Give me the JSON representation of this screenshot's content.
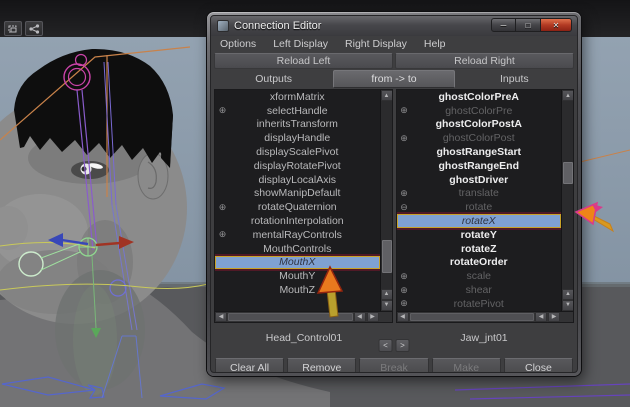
{
  "colors": {
    "selection_bg": "#7fa1d2",
    "selection_border": "#c9a227",
    "annotation_orange": "#e8791e",
    "annotation_pink": "#d83a8c",
    "close_button_red": "#b23a23",
    "viewport_sky": "#8a99a8",
    "viewport_ground": "#58595c"
  },
  "viewport": {
    "toolbar_icons": [
      "frame-icon",
      "share-icon"
    ]
  },
  "dialog": {
    "title": "Connection Editor",
    "menu_items": [
      "Options",
      "Left Display",
      "Right Display",
      "Help"
    ],
    "reload_buttons": [
      "Reload Left",
      "Reload Right"
    ],
    "tabs": [
      "Outputs",
      "from -> to",
      "Inputs"
    ],
    "left_list": {
      "items": [
        {
          "label": "xformMatrix",
          "style": "normal",
          "expand": ""
        },
        {
          "label": "selectHandle",
          "style": "normal",
          "expand": "+"
        },
        {
          "label": "inheritsTransform",
          "style": "normal",
          "expand": ""
        },
        {
          "label": "displayHandle",
          "style": "normal",
          "expand": ""
        },
        {
          "label": "displayScalePivot",
          "style": "normal",
          "expand": ""
        },
        {
          "label": "displayRotatePivot",
          "style": "normal",
          "expand": ""
        },
        {
          "label": "displayLocalAxis",
          "style": "normal",
          "expand": ""
        },
        {
          "label": "showManipDefault",
          "style": "normal",
          "expand": ""
        },
        {
          "label": "rotateQuaternion",
          "style": "normal",
          "expand": "+"
        },
        {
          "label": "rotationInterpolation",
          "style": "normal",
          "expand": ""
        },
        {
          "label": "mentalRayControls",
          "style": "normal",
          "expand": "+"
        },
        {
          "label": "MouthControls",
          "style": "normal",
          "expand": ""
        },
        {
          "label": "MouthX",
          "style": "selected",
          "expand": ""
        },
        {
          "label": "MouthY",
          "style": "normal",
          "expand": ""
        },
        {
          "label": "MouthZ",
          "style": "normal",
          "expand": ""
        }
      ],
      "footer": "Head_Control01"
    },
    "right_list": {
      "items": [
        {
          "label": "ghostColorPreA",
          "style": "bold",
          "expand": ""
        },
        {
          "label": "ghostColorPre",
          "style": "dim",
          "expand": "+"
        },
        {
          "label": "ghostColorPostA",
          "style": "bold",
          "expand": ""
        },
        {
          "label": "ghostColorPost",
          "style": "dim",
          "expand": "+"
        },
        {
          "label": "ghostRangeStart",
          "style": "bold",
          "expand": ""
        },
        {
          "label": "ghostRangeEnd",
          "style": "bold",
          "expand": ""
        },
        {
          "label": "ghostDriver",
          "style": "bold",
          "expand": ""
        },
        {
          "label": "translate",
          "style": "dim",
          "expand": "+"
        },
        {
          "label": "rotate",
          "style": "dim",
          "expand": "-"
        },
        {
          "label": "rotateX",
          "style": "selected",
          "expand": ""
        },
        {
          "label": "rotateY",
          "style": "bold",
          "expand": ""
        },
        {
          "label": "rotateZ",
          "style": "bold",
          "expand": ""
        },
        {
          "label": "rotateOrder",
          "style": "bold",
          "expand": ""
        },
        {
          "label": "scale",
          "style": "dim",
          "expand": "+"
        },
        {
          "label": "shear",
          "style": "dim",
          "expand": "+"
        },
        {
          "label": "rotatePivot",
          "style": "dim",
          "expand": "+"
        }
      ],
      "footer": "Jaw_jnt01"
    },
    "nav_buttons": [
      "<",
      ">"
    ],
    "bottom_buttons": [
      {
        "label": "Clear All",
        "enabled": true
      },
      {
        "label": "Remove",
        "enabled": true
      },
      {
        "label": "Break",
        "enabled": false
      },
      {
        "label": "Make",
        "enabled": false
      },
      {
        "label": "Close",
        "enabled": true
      }
    ]
  }
}
